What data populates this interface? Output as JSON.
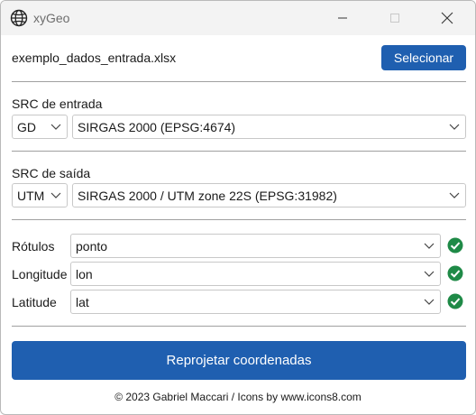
{
  "window": {
    "title": "xyGeo",
    "controls": {
      "minimize": "minimize",
      "maximize": "maximize",
      "close": "close"
    }
  },
  "file": {
    "name": "exemplo_dados_entrada.xlsx",
    "select_label": "Selecionar"
  },
  "src_input": {
    "label": "SRC de entrada",
    "type_value": "GD",
    "crs_value": "SIRGAS 2000 (EPSG:4674)"
  },
  "src_output": {
    "label": "SRC de saída",
    "type_value": "UTM",
    "crs_value": "SIRGAS 2000 / UTM zone 22S (EPSG:31982)"
  },
  "fields": [
    {
      "label": "Rótulos",
      "value": "ponto",
      "status": "ok"
    },
    {
      "label": "Longitude",
      "value": "lon",
      "status": "ok"
    },
    {
      "label": "Latitude",
      "value": "lat",
      "status": "ok"
    }
  ],
  "action": {
    "label": "Reprojetar coordenadas"
  },
  "footer": {
    "text": "© 2023 Gabriel Maccari / Icons by www.icons8.com"
  },
  "colors": {
    "accent": "#1f5fb0",
    "success": "#1f8a47"
  },
  "icons": [
    "globe-icon",
    "minimize-icon",
    "maximize-icon",
    "close-icon",
    "chevron-down-icon",
    "check-circle-icon"
  ]
}
